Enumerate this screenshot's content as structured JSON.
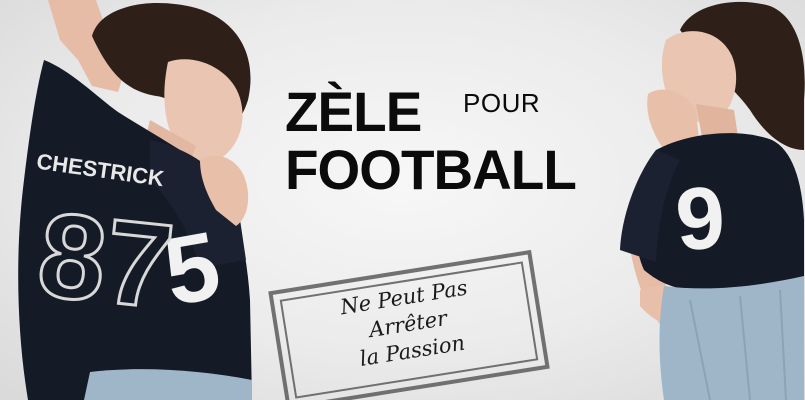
{
  "headline": {
    "word1": "ZÈLE",
    "word2": "POUR",
    "word3": "FOOTBALL"
  },
  "stamp": {
    "line1": "Ne Peut Pas",
    "line2": "Arrêter",
    "line3": "la Passion"
  },
  "figures": {
    "left": {
      "number": "5",
      "chest_text": "CHESTRICK"
    },
    "right": {
      "number": "9"
    }
  },
  "colors": {
    "background": "#ececec",
    "jersey": "#141a26",
    "skin": "#e9c2ad",
    "hair": "#2e2018",
    "denim": "#9fb6c8",
    "headline": "#0b0b0b",
    "stamp": "#5a5a5a"
  }
}
